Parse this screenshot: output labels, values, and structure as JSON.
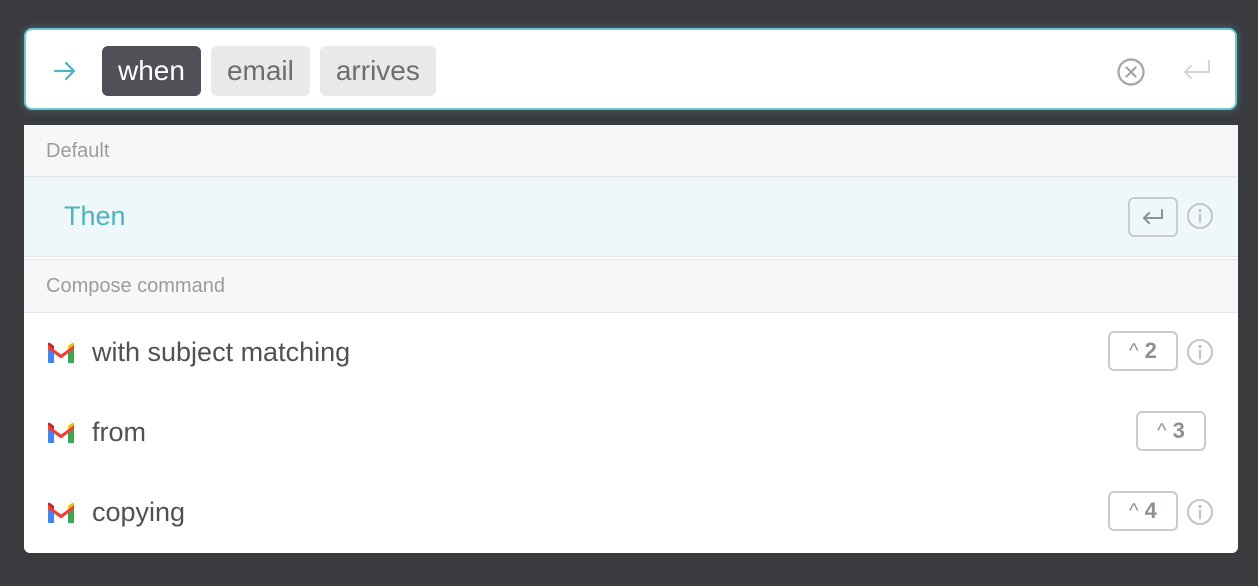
{
  "command_bar": {
    "chips": [
      {
        "label": "when",
        "active": true
      },
      {
        "label": "email",
        "active": false
      },
      {
        "label": "arrives",
        "active": false
      }
    ],
    "leading_icon": "arrow-right-icon",
    "clear_icon": "clear-circle-icon",
    "submit_icon": "return-icon"
  },
  "sections": [
    {
      "header": "Default",
      "items": [
        {
          "label": "Then",
          "shortcut_icon": "return-icon",
          "info_icon": "info-icon",
          "selected": true
        }
      ]
    },
    {
      "header": "Compose command",
      "items": [
        {
          "label": "with subject matching",
          "icon": "gmail-icon",
          "shortcut_modifier": "^",
          "shortcut_key": "2",
          "info_icon": "info-icon"
        },
        {
          "label": "from",
          "icon": "gmail-icon",
          "shortcut_modifier": "^",
          "shortcut_key": "3"
        },
        {
          "label": "copying",
          "icon": "gmail-icon",
          "shortcut_modifier": "^",
          "shortcut_key": "4",
          "info_icon": "info-icon"
        }
      ]
    }
  ],
  "colors": {
    "accent": "#4fb3bf",
    "focus_border": "#6cc8cf",
    "active_chip": "#505156",
    "background": "#3a3b3f"
  }
}
